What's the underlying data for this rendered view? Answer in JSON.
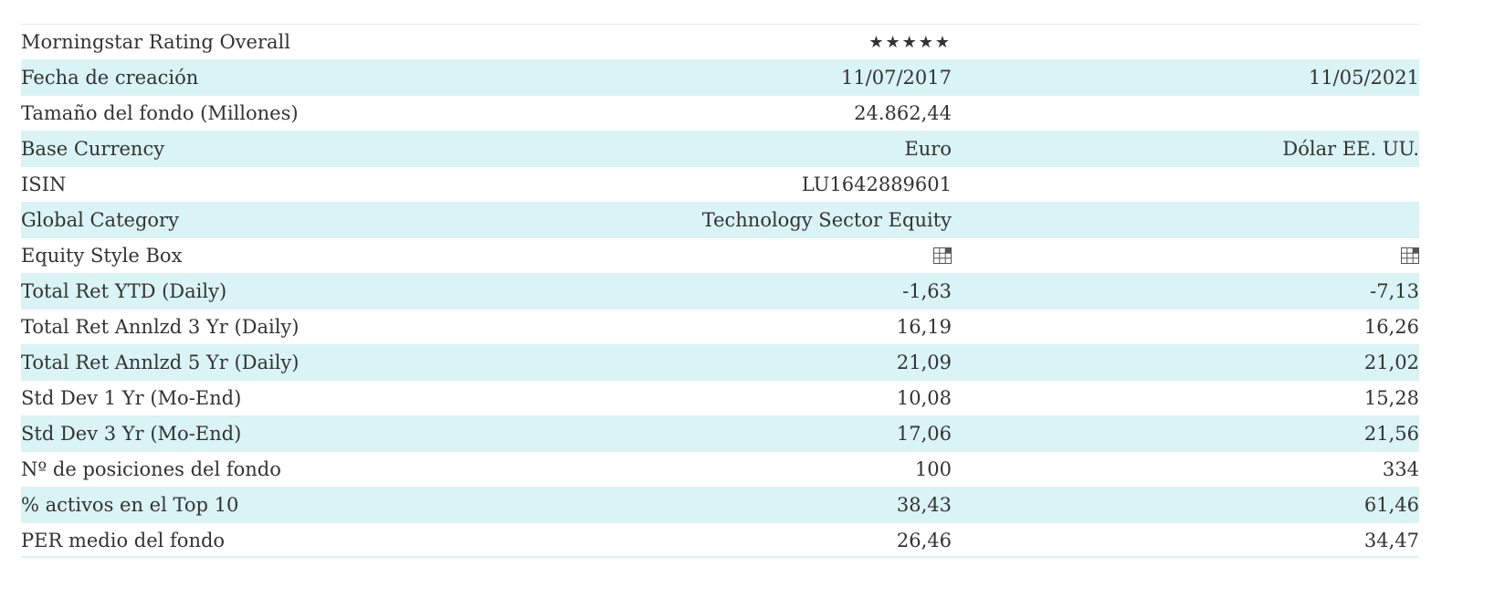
{
  "rows": [
    {
      "label": "Morningstar Rating Overall",
      "v1": "★★★★★",
      "v2": "",
      "shaded": false,
      "kind": "stars"
    },
    {
      "label": "Fecha de creación",
      "v1": "11/07/2017",
      "v2": "11/05/2021",
      "shaded": true
    },
    {
      "label": "Tamaño del fondo (Millones)",
      "v1": "24.862,44",
      "v2": "",
      "shaded": false
    },
    {
      "label": "Base Currency",
      "v1": "Euro",
      "v2": "Dólar EE. UU.",
      "shaded": true
    },
    {
      "label": "ISIN",
      "v1": "LU1642889601",
      "v2": "",
      "shaded": false
    },
    {
      "label": "Global Category",
      "v1": "Technology Sector Equity",
      "v2": "",
      "shaded": true
    },
    {
      "label": "Equity Style Box",
      "v1": "",
      "v2": "",
      "shaded": false,
      "kind": "stylebox",
      "stylebox_v1": "large-growth",
      "stylebox_v2": "large-growth"
    },
    {
      "label": "Total Ret YTD (Daily)",
      "v1": "-1,63",
      "v2": "-7,13",
      "shaded": true
    },
    {
      "label": "Total Ret Annlzd 3 Yr (Daily)",
      "v1": "16,19",
      "v2": "16,26",
      "shaded": false
    },
    {
      "label": "Total Ret Annlzd 5 Yr (Daily)",
      "v1": "21,09",
      "v2": "21,02",
      "shaded": true
    },
    {
      "label": "Std Dev 1 Yr (Mo-End)",
      "v1": "10,08",
      "v2": "15,28",
      "shaded": false
    },
    {
      "label": "Std Dev 3 Yr (Mo-End)",
      "v1": "17,06",
      "v2": "21,56",
      "shaded": true
    },
    {
      "label": "Nº de posiciones del fondo",
      "v1": "100",
      "v2": "334",
      "shaded": false
    },
    {
      "label": "% activos en el Top 10",
      "v1": "38,43",
      "v2": "61,46",
      "shaded": true
    },
    {
      "label": "PER medio del fondo",
      "v1": "26,46",
      "v2": "34,47",
      "shaded": false
    }
  ],
  "colors": {
    "shade": "#daf3f5",
    "text": "#333333"
  }
}
